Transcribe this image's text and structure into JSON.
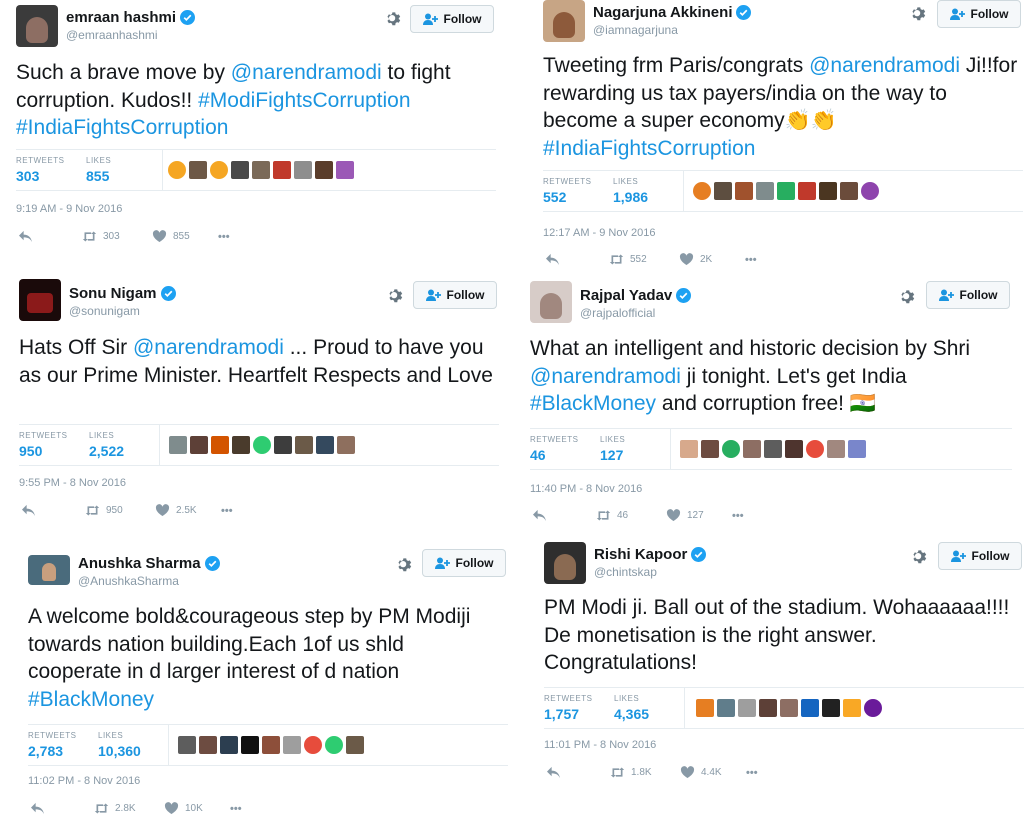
{
  "ui": {
    "follow_label": "Follow",
    "retweets_label": "RETWEETS",
    "likes_label": "LIKES",
    "more_label": "•••"
  },
  "colors": {
    "link": "#1b95e0",
    "muted": "#8899a6",
    "text": "#14171a",
    "verified": "#1da1f2"
  },
  "tweets": [
    {
      "name": "emraan hashmi",
      "handle": "@emraanhashmi",
      "text_parts": [
        "Such a brave move by ",
        "@narendramodi",
        " to fight corruption. Kudos!! ",
        "#ModiFightsCorruption",
        " ",
        "#IndiaFightsCorruption"
      ],
      "retweets": "303",
      "likes": "855",
      "time": "9:19 AM - 9 Nov 2016",
      "action_retweets": "303",
      "action_likes": "855"
    },
    {
      "name": "Nagarjuna Akkineni",
      "handle": "@iamnagarjuna",
      "text_parts": [
        "Tweeting frm Paris/congrats ",
        "@narendramodi",
        " Ji!!for rewarding us tax payers/india on the way to become a super economy👏👏 ",
        "#IndiaFightsCorruption",
        "",
        ""
      ],
      "retweets": "552",
      "likes": "1,986",
      "time": "12:17 AM - 9 Nov 2016",
      "action_retweets": "552",
      "action_likes": "2K"
    },
    {
      "name": "Sonu Nigam",
      "handle": "@sonunigam",
      "text_parts": [
        "Hats Off Sir ",
        "@narendramodi",
        "   ...  Proud to have you as our Prime Minister. Heartfelt Respects and Love",
        "",
        "",
        ""
      ],
      "retweets": "950",
      "likes": "2,522",
      "time": "9:55 PM - 8 Nov 2016",
      "action_retweets": "950",
      "action_likes": "2.5K"
    },
    {
      "name": "Rajpal Yadav",
      "handle": "@rajpalofficial",
      "text_parts": [
        "What an intelligent and historic decision by Shri ",
        "@narendramodi",
        " ji tonight. Let's get India ",
        "#BlackMoney",
        " and corruption free! 🇮🇳",
        ""
      ],
      "retweets": "46",
      "likes": "127",
      "time": "11:40 PM - 8 Nov 2016",
      "action_retweets": "46",
      "action_likes": "127"
    },
    {
      "name": "Anushka Sharma",
      "handle": "@AnushkaSharma",
      "text_parts": [
        "A welcome bold&courageous step by PM Modiji towards nation building.Each 1of us shld cooperate in d larger interest of d nation ",
        "",
        "",
        "#BlackMoney",
        "",
        ""
      ],
      "retweets": "2,783",
      "likes": "10,360",
      "time": "11:02 PM - 8 Nov 2016",
      "action_retweets": "2.8K",
      "action_likes": "10K"
    },
    {
      "name": "Rishi Kapoor",
      "handle": "@chintskap",
      "text_parts": [
        "PM Modi ji. Ball out of the stadium. Wohaaaaaa!!!! De monetisation is the right answer. Congratulations!",
        "",
        "",
        "",
        "",
        ""
      ],
      "retweets": "1,757",
      "likes": "4,365",
      "time": "11:01 PM - 8 Nov 2016",
      "action_retweets": "1.8K",
      "action_likes": "4.4K"
    }
  ]
}
